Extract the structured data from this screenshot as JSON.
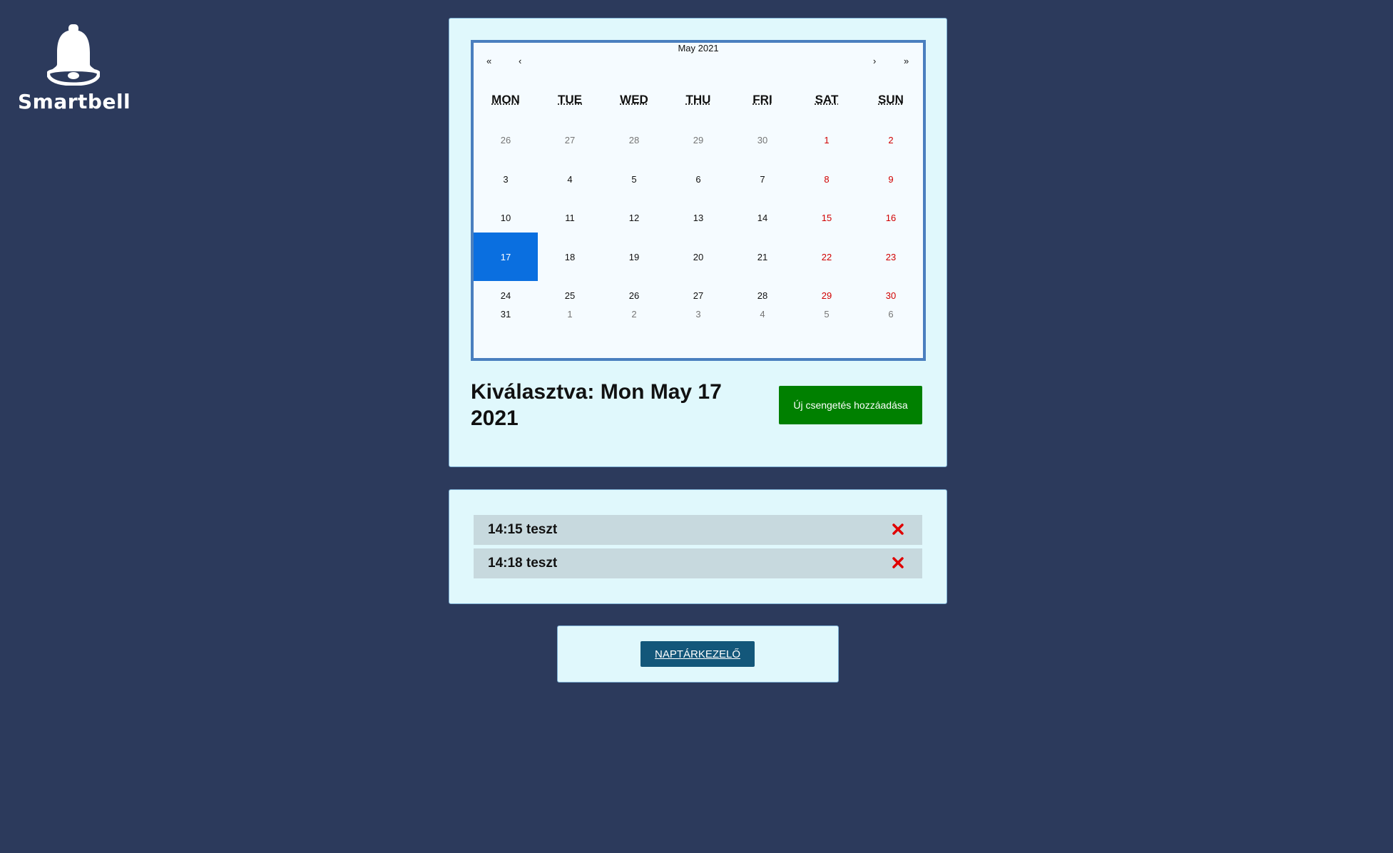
{
  "brand": {
    "name": "Smartbell",
    "icon": "bell-icon"
  },
  "calendar": {
    "prev_year": "«",
    "prev_month": "‹",
    "title": "May 2021",
    "next_month": "›",
    "next_year": "»",
    "weekdays": [
      "MON",
      "TUE",
      "WED",
      "THU",
      "FRI",
      "SAT",
      "SUN"
    ],
    "weeks": [
      [
        "26",
        "27",
        "28",
        "29",
        "30",
        "1",
        "2"
      ],
      [
        "3",
        "4",
        "5",
        "6",
        "7",
        "8",
        "9"
      ],
      [
        "10",
        "11",
        "12",
        "13",
        "14",
        "15",
        "16"
      ],
      [
        "17",
        "18",
        "19",
        "20",
        "21",
        "22",
        "23"
      ],
      [
        "24",
        "25",
        "26",
        "27",
        "28",
        "29",
        "30"
      ],
      [
        "31",
        "1",
        "2",
        "3",
        "4",
        "5",
        "6"
      ]
    ],
    "selected_day": "17"
  },
  "selection": {
    "label": "Kiválasztva: Mon May 17 2021"
  },
  "add_button": {
    "label": "Új csengetés hozzáadása"
  },
  "bells": [
    {
      "label": "14:15 teszt"
    },
    {
      "label": "14:18 teszt"
    }
  ],
  "nav_button": {
    "label": "NAPTÁRKEZELŐ"
  },
  "colors": {
    "background": "#2c3a5c",
    "card": "#e0f8fc",
    "selected": "#0a6fe0",
    "weekend": "#d10000",
    "add": "#008000",
    "delete": "#e00000",
    "nav": "#13577a"
  }
}
